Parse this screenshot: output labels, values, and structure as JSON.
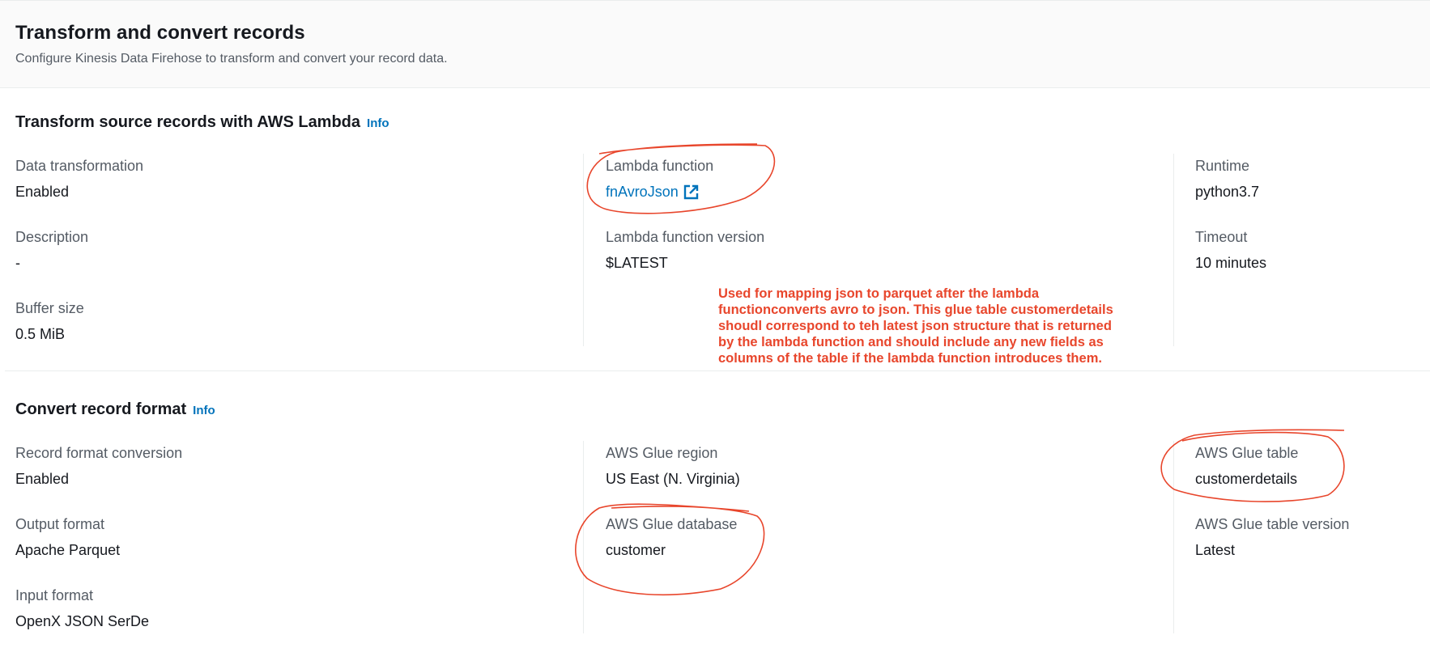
{
  "header": {
    "title": "Transform and convert records",
    "subtitle": "Configure Kinesis Data Firehose to transform and convert your record data."
  },
  "lambda_section": {
    "title": "Transform source records with AWS Lambda",
    "info": "Info",
    "data_transformation": {
      "label": "Data transformation",
      "value": "Enabled"
    },
    "description": {
      "label": "Description",
      "value": "-"
    },
    "buffer_size": {
      "label": "Buffer size",
      "value": "0.5 MiB"
    },
    "lambda_function": {
      "label": "Lambda function",
      "value": "fnAvroJson",
      "icon": "external-link-icon"
    },
    "lambda_function_version": {
      "label": "Lambda function version",
      "value": "$LATEST"
    },
    "runtime": {
      "label": "Runtime",
      "value": "python3.7"
    },
    "timeout": {
      "label": "Timeout",
      "value": "10 minutes"
    }
  },
  "annotation": {
    "lines": [
      "Used for mapping json to parquet after the lambda",
      "functionconverts avro to json. This glue table customerdetails",
      "shoudl correspond to teh latest json structure that is returned",
      "by the lambda function and should include any new fields as",
      "columns of the table if the lambda function introduces them."
    ],
    "color": "#e8462c"
  },
  "convert_section": {
    "title": "Convert record format",
    "info": "Info",
    "record_format_conversion": {
      "label": "Record format conversion",
      "value": "Enabled"
    },
    "output_format": {
      "label": "Output format",
      "value": "Apache Parquet"
    },
    "input_format": {
      "label": "Input format",
      "value": "OpenX JSON SerDe"
    },
    "glue_region": {
      "label": "AWS Glue region",
      "value": "US East (N. Virginia)"
    },
    "glue_database": {
      "label": "AWS Glue database",
      "value": "customer"
    },
    "glue_table": {
      "label": "AWS Glue table",
      "value": "customerdetails"
    },
    "glue_table_version": {
      "label": "AWS Glue table version",
      "value": "Latest"
    }
  },
  "colors": {
    "link": "#0073bb",
    "label": "#545b64",
    "annotation": "#e8462c"
  }
}
